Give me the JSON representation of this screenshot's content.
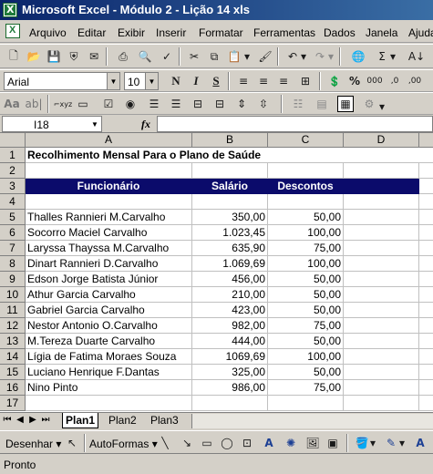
{
  "window": {
    "title": "Microsoft Excel - Módulo 2 - Lição 14 xls"
  },
  "menu": [
    "Arquivo",
    "Editar",
    "Exibir",
    "Inserir",
    "Formatar",
    "Ferramentas",
    "Dados",
    "Janela",
    "Ajuda"
  ],
  "format_toolbar": {
    "font": "Arial",
    "size": "10"
  },
  "formula_bar": {
    "name_box": "I18",
    "fx": "fx",
    "formula": ""
  },
  "columns": [
    "A",
    "B",
    "C",
    "D"
  ],
  "sheet": {
    "title": "Recolhimento Mensal Para o Plano de Saúde",
    "headers": [
      "Funcionário",
      "Salário",
      "Descontos"
    ],
    "rows": [
      [
        "Thalles Rannieri M.Carvalho",
        "350,00",
        "50,00"
      ],
      [
        "Socorro Maciel Carvalho",
        "1.023,45",
        "100,00"
      ],
      [
        "Laryssa Thayssa M.Carvalho",
        "635,90",
        "75,00"
      ],
      [
        "Dinart Rannieri D.Carvalho",
        "1.069,69",
        "100,00"
      ],
      [
        "Edson Jorge Batista Júnior",
        "456,00",
        "50,00"
      ],
      [
        "Athur Garcia Carvalho",
        "210,00",
        "50,00"
      ],
      [
        "Gabriel Garcia Carvalho",
        "423,00",
        "50,00"
      ],
      [
        "Nestor Antonio O.Carvalho",
        "982,00",
        "75,00"
      ],
      [
        "M.Tereza Duarte Carvalho",
        "444,00",
        "50,00"
      ],
      [
        "Lígia de Fatima Moraes Souza",
        "1069,69",
        "100,00"
      ],
      [
        "Luciano Henrique F.Dantas",
        "325,00",
        "50,00"
      ],
      [
        "Nino Pinto",
        "986,00",
        "75,00"
      ]
    ],
    "row_numbers": [
      "1",
      "2",
      "3",
      "4",
      "5",
      "6",
      "7",
      "8",
      "9",
      "10",
      "11",
      "12",
      "13",
      "14",
      "15",
      "16",
      "17"
    ]
  },
  "sheet_tabs": [
    "Plan1",
    "Plan2",
    "Plan3"
  ],
  "draw_toolbar": {
    "draw": "Desenhar",
    "autoshapes": "AutoFormas"
  },
  "status": "Pronto"
}
